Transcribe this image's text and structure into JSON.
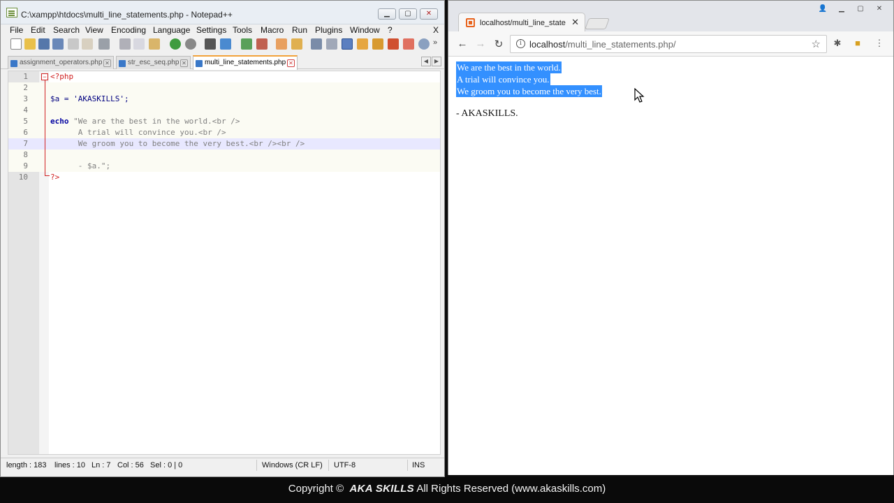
{
  "notepad": {
    "title": "C:\\xampp\\htdocs\\multi_line_statements.php - Notepad++",
    "window_buttons": {
      "minimize": "▁",
      "maximize": "▢",
      "close": "✕"
    },
    "menu": [
      "File",
      "Edit",
      "Search",
      "View",
      "Encoding",
      "Language",
      "Settings",
      "Tools",
      "Macro",
      "Run",
      "Plugins",
      "Window",
      "?"
    ],
    "menu_close": "X",
    "tabs": [
      {
        "label": "assignment_operators.php",
        "active": false
      },
      {
        "label": "str_esc_seq.php",
        "active": false
      },
      {
        "label": "multi_line_statements.php",
        "active": true
      }
    ],
    "tab_close": "✕",
    "tab_scroll": {
      "left": "◀",
      "right": "▶"
    },
    "lines": [
      {
        "num": "1",
        "text": "<?php"
      },
      {
        "num": "2",
        "text": ""
      },
      {
        "num": "3",
        "text": "$a = 'AKASKILLS';"
      },
      {
        "num": "4",
        "text": ""
      },
      {
        "num": "5",
        "kw": "echo",
        "text": " \"We are the best in the world.<br />"
      },
      {
        "num": "6",
        "text": "      A trial will convince you.<br />"
      },
      {
        "num": "7",
        "text": "      We groom you to become the very best.<br /><br />"
      },
      {
        "num": "8",
        "text": ""
      },
      {
        "num": "9",
        "text": "      - $a.\";"
      },
      {
        "num": "10",
        "text": "?>"
      }
    ],
    "fold_marker": "−",
    "status": {
      "length": "length : 183",
      "lines": "lines : 10",
      "ln": "Ln : 7",
      "col": "Col : 56",
      "sel": "Sel : 0 | 0",
      "eol": "Windows (CR LF)",
      "encoding": "UTF-8",
      "mode": "INS"
    }
  },
  "browser": {
    "tab_title": "localhost/multi_line_state",
    "tab_close": "✕",
    "window_buttons": {
      "user": "👤",
      "minimize": "▁",
      "maximize": "▢",
      "close": "✕"
    },
    "nav": {
      "back": "←",
      "forward": "→",
      "reload": "↻"
    },
    "url_host": "localhost",
    "url_path": "/multi_line_statements.php/",
    "info_icon": "i",
    "star": "☆",
    "menu_icon": "⋮",
    "page_lines": [
      "We are the best in the world.",
      "A trial will convince you.",
      "We groom you to become the very best."
    ],
    "signature": "- AKASKILLS."
  },
  "banner": {
    "copyright": "Copyright ©",
    "brand": "AKA SKILLS",
    "rights": "All Rights Reserved (www.akaskills.com)"
  }
}
